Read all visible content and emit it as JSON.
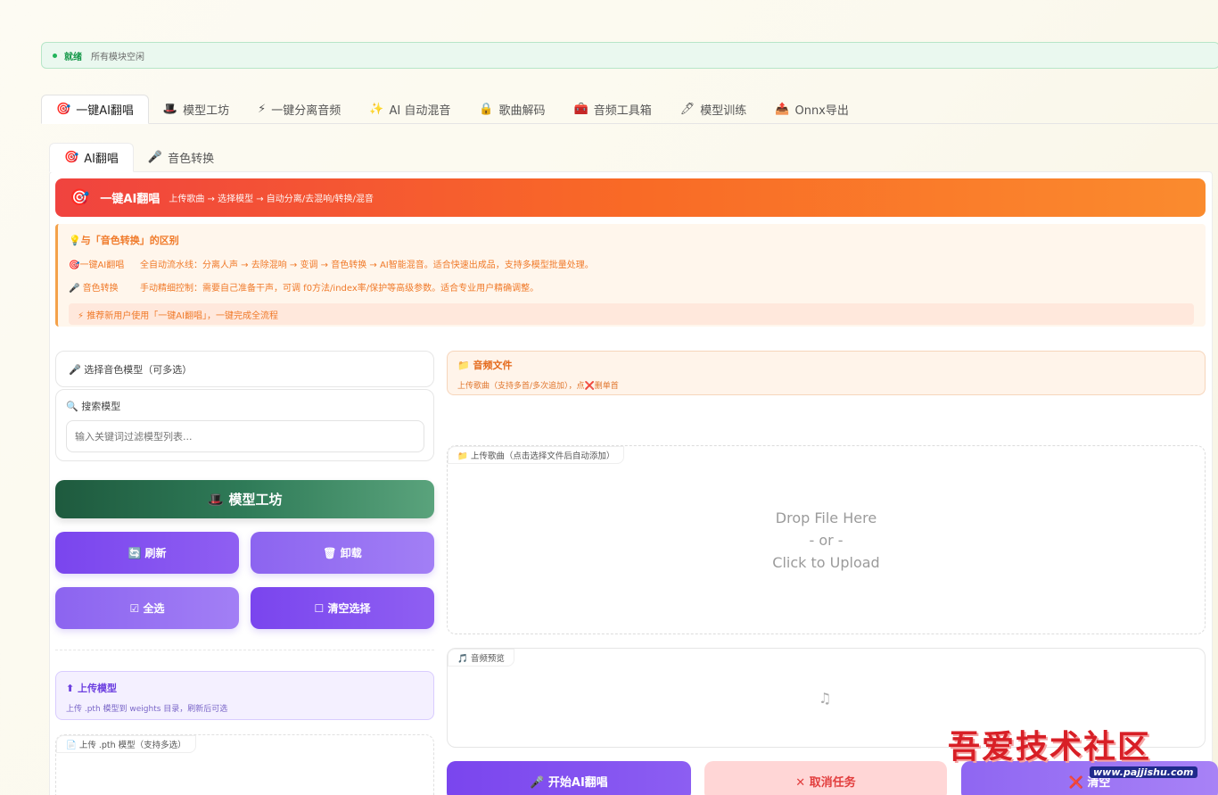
{
  "status": {
    "state": "就绪",
    "message": "所有模块空闲"
  },
  "main_tabs": [
    {
      "icon": "🎯",
      "label": "一键AI翻唱"
    },
    {
      "icon": "🎩",
      "label": "模型工坊"
    },
    {
      "icon": "⚡",
      "label": "一键分离音频"
    },
    {
      "icon": "✨",
      "label": "AI 自动混音"
    },
    {
      "icon": "🔒",
      "label": "歌曲解码"
    },
    {
      "icon": "🧰",
      "label": "音频工具箱"
    },
    {
      "icon": "🖊",
      "label": "模型训练"
    },
    {
      "icon": "📤",
      "label": "Onnx导出"
    }
  ],
  "sub_tabs": [
    {
      "icon": "🎯",
      "label": "AI翻唱"
    },
    {
      "icon": "🎤",
      "label": "音色转换"
    }
  ],
  "banner": {
    "icon": "🎯",
    "title": "一键AI翻唱",
    "subtitle": "上传歌曲 → 选择模型 → 自动分离/去混响/转换/混音"
  },
  "diff": {
    "title": "💡与「音色转换」的区别",
    "row1_label": "🎯一键AI翻唱",
    "row1_text": "全自动流水线：分离人声 → 去除混响 → 变调 → 音色转换 → AI智能混音。适合快速出成品，支持多模型批量处理。",
    "row2_label": "🎤 音色转换",
    "row2_text": "手动精细控制：需要自己准备干声，可调 f0方法/index率/保护等高级参数。适合专业用户精确调整。",
    "note": "⚡ 推荐新用户使用「一键AI翻唱」，一键完成全流程"
  },
  "model_select": {
    "label": "🎤 选择音色模型（可多选）"
  },
  "search": {
    "label": "🔍 搜索模型",
    "placeholder": "输入关键词过滤模型列表..."
  },
  "workshop_button": "🎩 模型工坊",
  "buttons": {
    "refresh": "🔄 刷新",
    "unload": "🗑 卸载",
    "select_all": "☑ 全选",
    "clear_select": "☐ 清空选择"
  },
  "upload_model": {
    "title": "⬆ 上传模型",
    "subtitle": "上传 .pth 模型到 weights 目录，刷新后可选",
    "chip": "📄 上传 .pth 模型（支持多选）"
  },
  "audio_file": {
    "title": "📁 音频文件",
    "subtitle": "上传歌曲（支持多首/多次追加），点❌删单首"
  },
  "dropzone": {
    "chip": "📁 上传歌曲（点击选择文件后自动添加）",
    "line1": "Drop File Here",
    "line2": "- or -",
    "line3": "Click to Upload"
  },
  "preview": {
    "chip": "🎵 音频预览",
    "icon": "♫"
  },
  "actions": {
    "start": "🎤 开始AI翻唱",
    "cancel": "✕ 取消任务",
    "clear": "❌ 清空"
  },
  "watermark": {
    "text": "吾爱技术社区",
    "url": "www.pajjishu.com"
  }
}
